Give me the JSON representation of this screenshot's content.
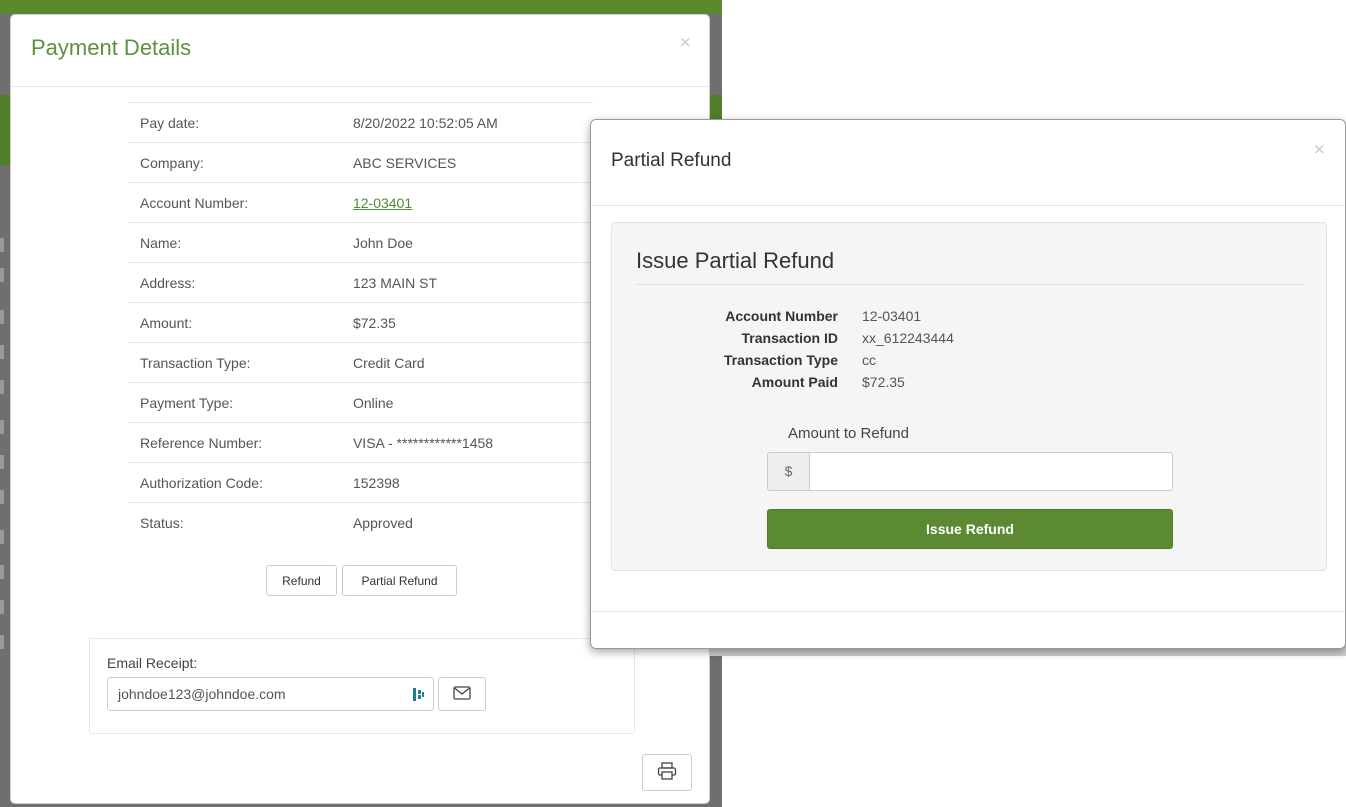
{
  "payment_modal": {
    "title": "Payment Details",
    "close_glyph": "×",
    "rows": [
      {
        "label": "Pay date:",
        "value": "8/20/2022 10:52:05 AM"
      },
      {
        "label": "Company:",
        "value": "ABC SERVICES"
      },
      {
        "label": "Account Number:",
        "value": "12-03401"
      },
      {
        "label": "Name:",
        "value": "John Doe"
      },
      {
        "label": "Address:",
        "value": "123 MAIN ST"
      },
      {
        "label": "Amount:",
        "value": "$72.35"
      },
      {
        "label": "Transaction Type:",
        "value": "Credit Card"
      },
      {
        "label": "Payment Type:",
        "value": "Online"
      },
      {
        "label": "Reference Number:",
        "value": "VISA - ************1458"
      },
      {
        "label": "Authorization Code:",
        "value": "152398"
      },
      {
        "label": "Status:",
        "value": "Approved"
      }
    ],
    "buttons": {
      "refund": "Refund",
      "partial_refund": "Partial Refund"
    },
    "email": {
      "label": "Email Receipt:",
      "value": "johndoe123@johndoe.com",
      "send_icon": "envelope-icon"
    },
    "print_icon": "printer-icon",
    "colors": {
      "title": "#5c9140",
      "link": "#4f8a37",
      "approved": "#5eb446"
    }
  },
  "refund_modal": {
    "title": "Partial Refund",
    "close_glyph": "×",
    "panel_title": "Issue Partial Refund",
    "details": [
      {
        "label": "Account Number",
        "value": "12-03401"
      },
      {
        "label": "Transaction ID",
        "value": "xx_612243444"
      },
      {
        "label": "Transaction Type",
        "value": "cc"
      },
      {
        "label": "Amount Paid",
        "value": "$72.35"
      }
    ],
    "amount_label": "Amount to Refund",
    "currency_addon": "$",
    "amount_value": "",
    "submit_label": "Issue Refund",
    "colors": {
      "submit": "#5b8a33"
    }
  }
}
